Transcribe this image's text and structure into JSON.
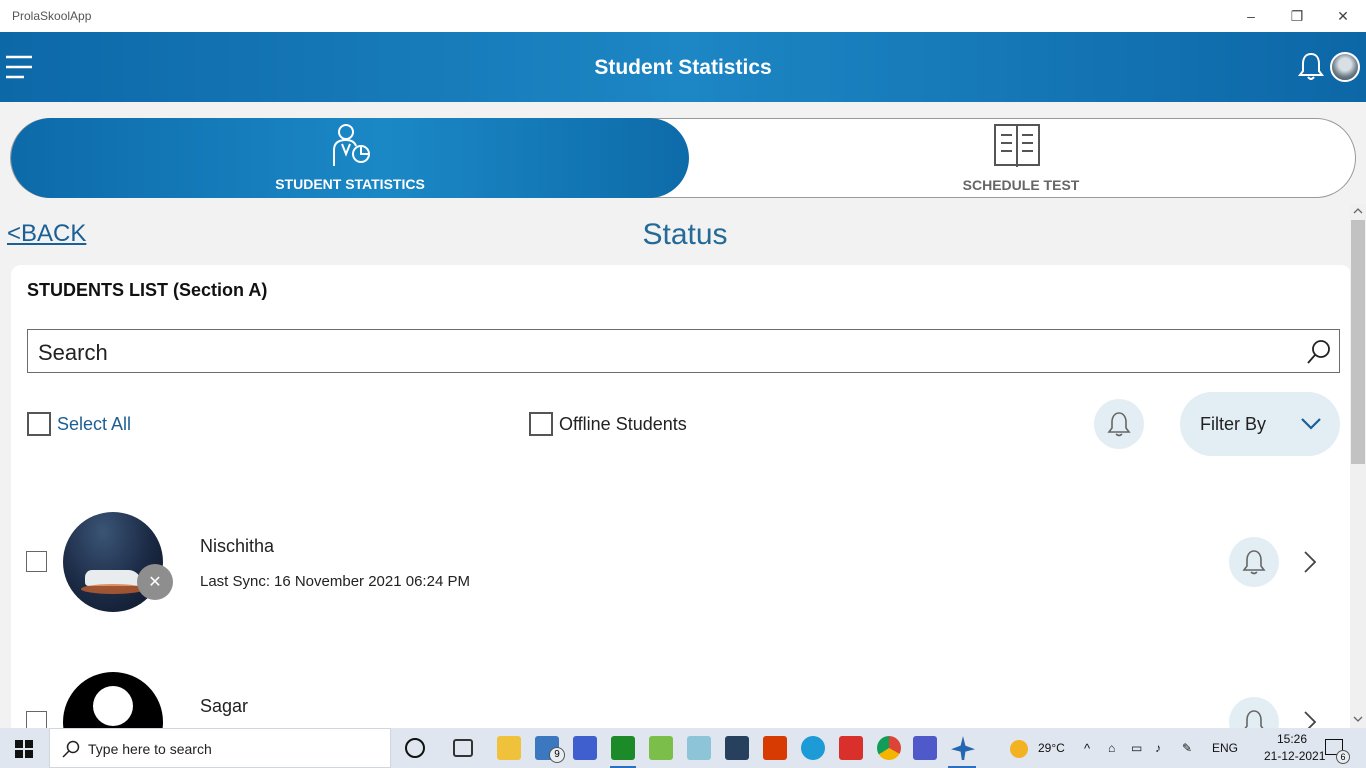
{
  "window": {
    "title": "ProlaSkoolApp",
    "controls": [
      "–",
      "❐",
      "✕"
    ]
  },
  "appbar": {
    "title": "Student Statistics"
  },
  "tabs": [
    {
      "label": "STUDENT STATISTICS",
      "active": true
    },
    {
      "label": "SCHEDULE TEST",
      "active": false
    }
  ],
  "nav": {
    "back": "<BACK",
    "page_title": "Status"
  },
  "list": {
    "title": "STUDENTS LIST (Section A)",
    "search_placeholder": "Search",
    "select_all": "Select All",
    "offline_students": "Offline Students",
    "filter_by": "Filter By"
  },
  "students": [
    {
      "name": "Nischitha",
      "sync_label": "Last Sync:",
      "sync_value": "16 November 2021 06:24 PM"
    },
    {
      "name": "Sagar"
    }
  ],
  "taskbar": {
    "search_placeholder": "Type here to search",
    "mail_badge": "9",
    "weather": "29°C",
    "language": "ENG",
    "time": "15:26",
    "date": "21-12-2021",
    "notifications": "6"
  },
  "colors": {
    "brand": "#1478b8",
    "link": "#1d5f93",
    "pill": "#e3eef4"
  }
}
